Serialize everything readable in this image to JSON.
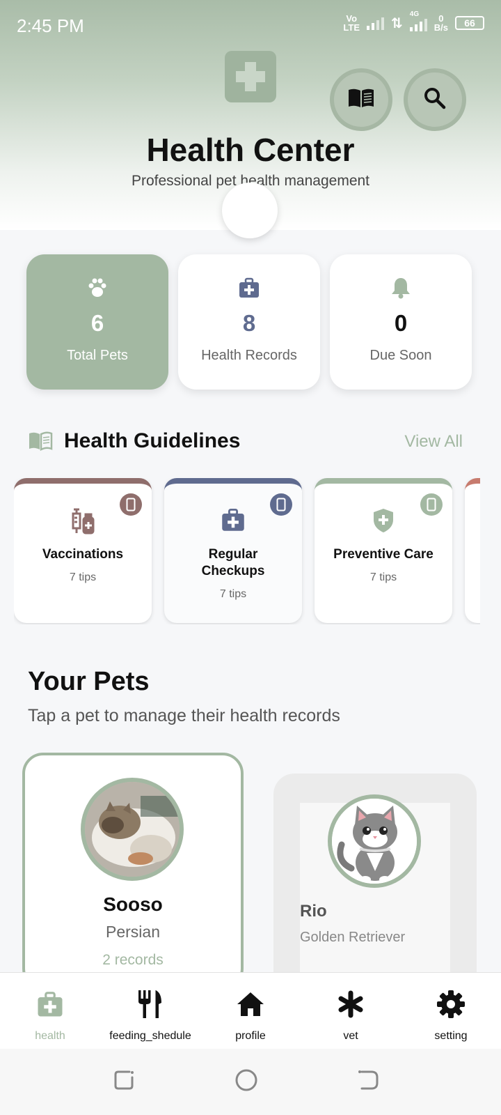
{
  "status_bar": {
    "time": "2:45 PM",
    "network_top": "Vo",
    "network_bottom": "LTE",
    "net_type": "4G",
    "speed_value": "0",
    "speed_unit": "B/s",
    "battery": "66"
  },
  "header": {
    "title": "Health Center",
    "subtitle": "Professional pet health management",
    "logo_icon": "medical-cross-icon",
    "book_button_icon": "book-icon",
    "search_button_icon": "search-icon"
  },
  "stats": [
    {
      "icon": "paw-icon",
      "value": "6",
      "label": "Total Pets",
      "active": true
    },
    {
      "icon": "medical-kit-icon",
      "value": "8",
      "label": "Health Records",
      "active": false
    },
    {
      "icon": "bell-icon",
      "value": "0",
      "label": "Due Soon",
      "active": false
    }
  ],
  "guidelines": {
    "title": "Health Guidelines",
    "view_all": "View All",
    "cards": [
      {
        "title": "Vaccinations",
        "tips": "7 tips",
        "icon": "syringe-icon",
        "color": "#8f6e6c"
      },
      {
        "title": "Regular Checkups",
        "tips": "7 tips",
        "icon": "medical-kit-icon",
        "color": "#5f6b8f"
      },
      {
        "title": "Preventive Care",
        "tips": "7 tips",
        "icon": "shield-icon",
        "color": "#a3b8a2"
      }
    ]
  },
  "pets": {
    "title": "Your Pets",
    "subtitle": "Tap a pet to manage their health records",
    "items": [
      {
        "name": "Sooso",
        "breed": "Persian",
        "records": "2 records"
      },
      {
        "name": "Rio",
        "breed": "Golden Retriever",
        "records": ""
      }
    ]
  },
  "tabs": [
    {
      "label": "health",
      "icon": "medical-kit-icon",
      "active": true
    },
    {
      "label": "feeding_shedule",
      "icon": "utensils-icon",
      "active": false
    },
    {
      "label": "profile",
      "icon": "home-icon",
      "active": false
    },
    {
      "label": "vet",
      "icon": "asterisk-icon",
      "active": false
    },
    {
      "label": "setting",
      "icon": "gear-icon",
      "active": false
    }
  ],
  "colors": {
    "accent": "#a3b8a2",
    "vaccinations": "#8f6e6c",
    "checkups": "#5f6b8f"
  }
}
